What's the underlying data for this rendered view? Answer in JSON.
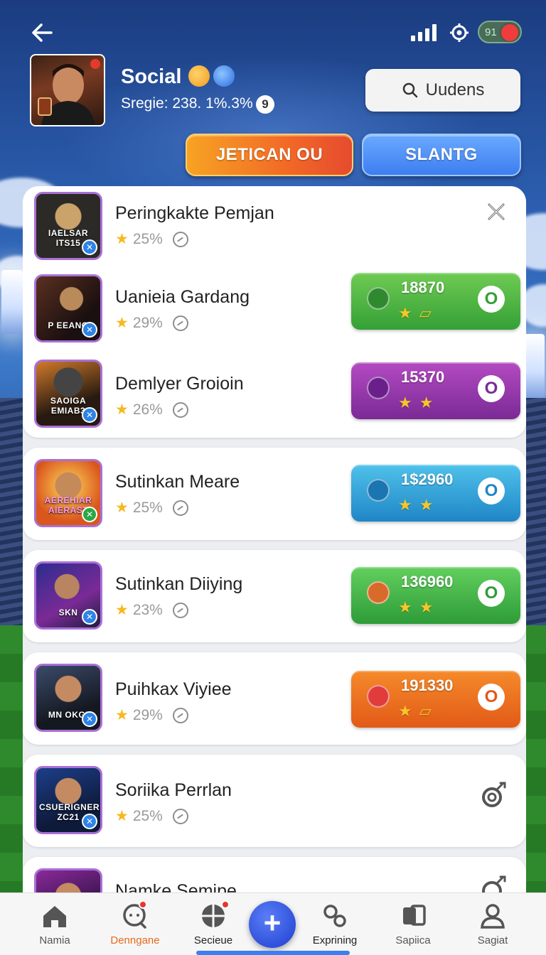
{
  "status": {
    "toggle_text": "91"
  },
  "profile": {
    "name": "Social",
    "stats": "Sregie: 238. 1%.3%",
    "info_glyph": "9"
  },
  "search": {
    "label": "Uudens"
  },
  "actions": {
    "primary_label": "JETICAN OU",
    "secondary_label": "SLANTG"
  },
  "games": [
    {
      "title": "Peringkakte Pemjan",
      "rating": "25%",
      "thumb_caption": "IAELSAR ITS15",
      "action": "close"
    },
    {
      "title": "Uanieia Gardang",
      "rating": "29%",
      "thumb_caption": "P EEANO",
      "reward": {
        "amount": "18870",
        "badge": "O",
        "color": "green"
      }
    },
    {
      "title": "Demlyer Groioin",
      "rating": "26%",
      "thumb_caption": "SAOIGA EMIAB3",
      "reward": {
        "amount": "15370",
        "badge": "O",
        "color": "purple"
      }
    },
    {
      "title": "Sutinkan Meare",
      "rating": "25%",
      "thumb_caption": "AEREHIAR AIERAST",
      "reward": {
        "amount": "1$2960",
        "badge": "O",
        "color": "blue"
      }
    },
    {
      "title": "Sutinkan Diiying",
      "rating": "23%",
      "thumb_caption": "SKN",
      "reward": {
        "amount": "136960",
        "badge": "O",
        "color": "green"
      }
    },
    {
      "title": "Puihkax Viyiee",
      "rating": "29%",
      "thumb_caption": "MN OKGI",
      "reward": {
        "amount": "191330",
        "badge": "O",
        "color": "orange"
      }
    },
    {
      "title": "Soriika Perrlan",
      "rating": "25%",
      "thumb_caption": "CSUERIGNER ZC21",
      "action": "gear"
    },
    {
      "title": "Namke Semipe",
      "rating": "",
      "thumb_caption": "",
      "action": "gear"
    }
  ],
  "nav": [
    {
      "label": "Namia",
      "icon": "home-icon"
    },
    {
      "label": "Denngane",
      "icon": "chat-icon"
    },
    {
      "label": "Secieue",
      "icon": "globe-icon"
    },
    {
      "label": "Exprining",
      "icon": "link-icon"
    },
    {
      "label": "Sapiica",
      "icon": "card-icon"
    },
    {
      "label": "Sagiat",
      "icon": "user-icon"
    }
  ],
  "fab": {
    "glyph": "+"
  },
  "colors": {
    "green": "#3cae3c",
    "purple": "#8b2fa3",
    "blue": "#2b8fd4",
    "orange": "#e8601e",
    "accent_orange": "#f26a26",
    "accent_blue": "#3d7ef0"
  }
}
